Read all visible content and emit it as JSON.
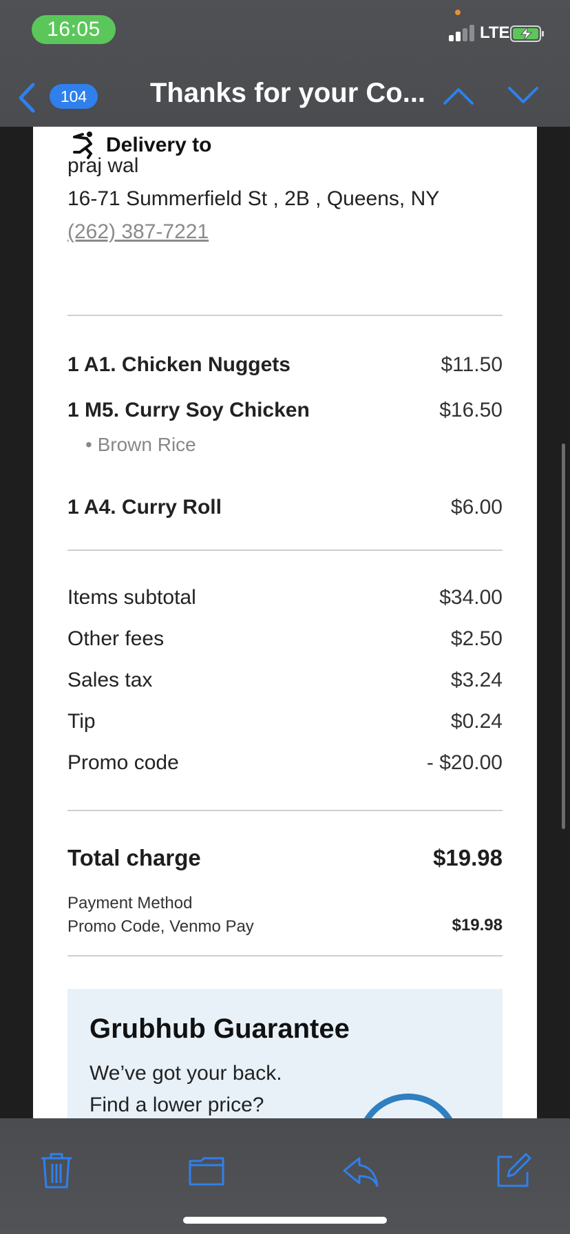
{
  "status_bar": {
    "time": "16:05",
    "network": "LTE",
    "icons": [
      "signal-icon",
      "battery-charging-icon"
    ]
  },
  "nav": {
    "back_icon": "chevron-left-icon",
    "unread_count": "104",
    "subject": "Thanks for your Co...",
    "prev_icon": "chevron-up-icon",
    "next_icon": "chevron-down-icon"
  },
  "delivery": {
    "heading": "Delivery to",
    "name": "praj wal",
    "address": "16-71 Summerfield St , 2B , Queens, NY",
    "phone": "(262) 387-7221"
  },
  "items": [
    {
      "name": "1 A1. Chicken Nuggets",
      "price": "$11.50"
    },
    {
      "name": "1 M5. Curry Soy Chicken",
      "price": "$16.50",
      "modifier": "• Brown Rice"
    },
    {
      "name": "1 A4. Curry Roll",
      "price": "$6.00"
    }
  ],
  "fees": [
    {
      "label": "Items subtotal",
      "amount": "$34.00"
    },
    {
      "label": "Other fees",
      "amount": "$2.50"
    },
    {
      "label": "Sales tax",
      "amount": "$3.24"
    },
    {
      "label": "Tip",
      "amount": "$0.24"
    },
    {
      "label": "Promo code",
      "amount": "- $20.00"
    }
  ],
  "total": {
    "label": "Total charge",
    "amount": "$19.98"
  },
  "payment": {
    "label": "Payment Method",
    "method": "Promo Code, Venmo Pay",
    "amount": "$19.98"
  },
  "guarantee": {
    "title": "Grubhub Guarantee",
    "line1": "We’ve got your back.",
    "line2": "Find a lower price?"
  },
  "toolbar": {
    "icons": [
      "trash-icon",
      "folder-icon",
      "reply-icon",
      "compose-icon"
    ]
  },
  "colors": {
    "accent": "#2f80ed",
    "status_green": "#5bc75a",
    "header_bg": "#4f5154",
    "guarantee_bg": "#e8f1f8"
  }
}
